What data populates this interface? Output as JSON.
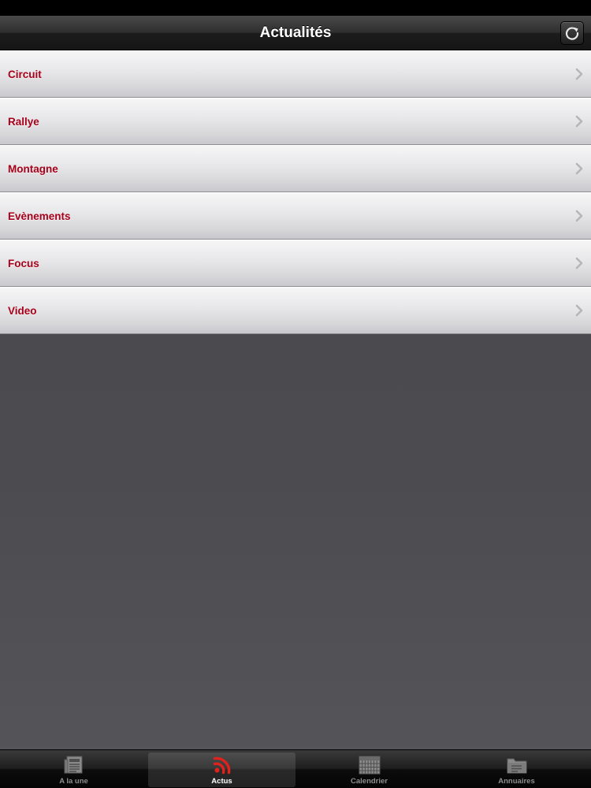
{
  "nav": {
    "title": "Actualités"
  },
  "colors": {
    "item_label": "#a8001a",
    "active_tab_icon": "#e0221d"
  },
  "list": {
    "items": [
      {
        "label": "Circuit"
      },
      {
        "label": "Rallye"
      },
      {
        "label": "Montagne"
      },
      {
        "label": "Evènements"
      },
      {
        "label": "Focus"
      },
      {
        "label": "Video"
      }
    ]
  },
  "tabbar": {
    "tabs": [
      {
        "label": "A la une",
        "icon": "newspaper-icon",
        "selected": false
      },
      {
        "label": "Actus",
        "icon": "rss-feed-icon",
        "selected": true
      },
      {
        "label": "Calendrier",
        "icon": "calendar-icon",
        "selected": false
      },
      {
        "label": "Annuaires",
        "icon": "folder-directory-icon",
        "selected": false
      }
    ]
  }
}
